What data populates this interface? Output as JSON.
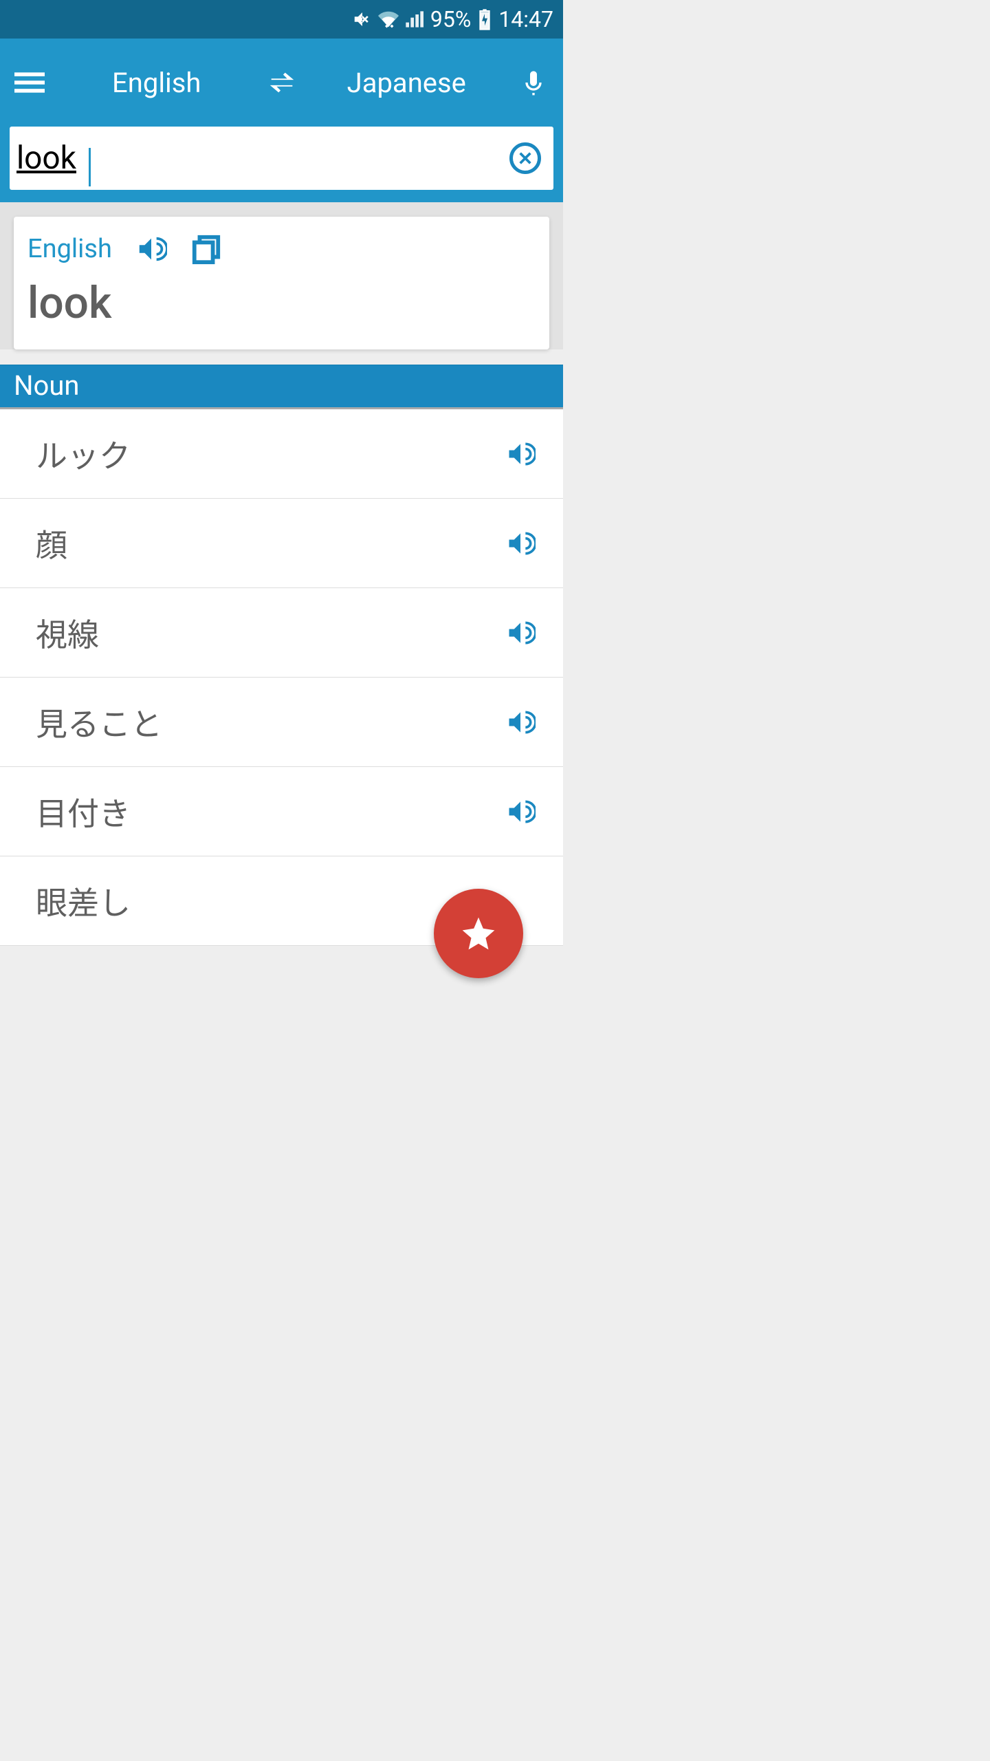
{
  "status": {
    "battery": "95%",
    "time": "14:47"
  },
  "header": {
    "source_lang": "English",
    "target_lang": "Japanese"
  },
  "search": {
    "value": "look"
  },
  "card": {
    "lang_label": "English",
    "word": "look"
  },
  "section": {
    "label": "Noun"
  },
  "results": [
    {
      "text": "ルック"
    },
    {
      "text": "顔"
    },
    {
      "text": "視線"
    },
    {
      "text": "見ること"
    },
    {
      "text": "目付き"
    },
    {
      "text": "眼差し"
    }
  ]
}
